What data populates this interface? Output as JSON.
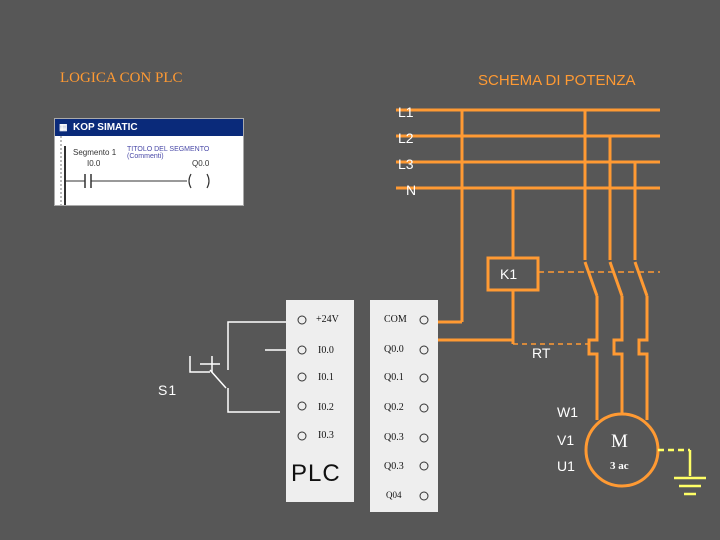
{
  "titles": {
    "left": "LOGICA CON PLC",
    "right": "SCHEMA DI POTENZA"
  },
  "bus_lines": [
    "L1",
    "L2",
    "L3",
    "N"
  ],
  "components": {
    "contactor": "K1",
    "thermal_relay": "RT",
    "switch": "S1"
  },
  "motor": {
    "symbol": "M",
    "supply": "3 ac",
    "terminals": [
      "W1",
      "V1",
      "U1"
    ]
  },
  "plc": {
    "label": "PLC",
    "inputs": [
      "+24V",
      "I0.0",
      "I0.1",
      "I0.2",
      "I0.3"
    ],
    "outputs": [
      "COM",
      "Q0.0",
      "Q0.1",
      "Q0.2",
      "Q0.3",
      "Q0.3",
      "Q04"
    ]
  },
  "kop_window": {
    "title": "KOP SIMATIC",
    "segment": "Segmento 1",
    "comment": "TITOLO DEL SEGMENTO (Commenti)",
    "contact": "I0.0",
    "coil": "Q0.0"
  },
  "colors": {
    "background": "#575757",
    "power_wire": "#ff9a33",
    "signal_wire": "#ffffff",
    "ground": "#ffff66",
    "terminal_block": "#eeeeee"
  }
}
